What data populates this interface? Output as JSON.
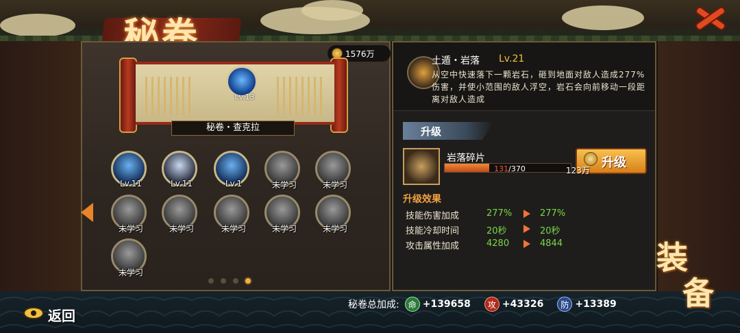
{
  "header": {
    "title": "秘卷"
  },
  "currency": {
    "amount": "1576万"
  },
  "scroll": {
    "name": "秘卷・查克拉",
    "level": "Lv.13"
  },
  "skills": [
    {
      "caption": "Lv.11",
      "state": "learned"
    },
    {
      "caption": "Lv.11",
      "state": "learned"
    },
    {
      "caption": "Lv.1",
      "state": "learned"
    },
    {
      "caption": "未学习",
      "state": "locked"
    },
    {
      "caption": "未学习",
      "state": "locked"
    },
    {
      "caption": "未学习",
      "state": "locked"
    },
    {
      "caption": "未学习",
      "state": "locked"
    },
    {
      "caption": "未学习",
      "state": "locked"
    },
    {
      "caption": "未学习",
      "state": "locked"
    },
    {
      "caption": "未学习",
      "state": "locked"
    },
    {
      "caption": "未学习",
      "state": "locked"
    }
  ],
  "pager": {
    "pages": 4,
    "current": 4
  },
  "detail": {
    "name": "土遁・岩落",
    "level": "Lv.21",
    "description": "从空中快速落下一颗岩石，砸到地面对敌人造成277%伤害，并使小范围的敌人浮空，岩石会向前移动一段距离对敌人造成"
  },
  "upgrade": {
    "section_title": "升级",
    "material_name": "岩落碎片",
    "material_current": "131",
    "material_required": "/370",
    "progress": 0.354,
    "cost": "123万",
    "button_label": "升级"
  },
  "effects": {
    "title": "升级效果",
    "rows": [
      {
        "label": "技能伤害加成",
        "current": "277%",
        "next": "277%"
      },
      {
        "label": "技能冷却时间",
        "current": "20秒",
        "next": "20秒"
      },
      {
        "label": "攻击属性加成",
        "current": "4280",
        "next": "4844"
      }
    ]
  },
  "equip_button": {
    "label_top": "装",
    "label_bottom": "备"
  },
  "footer": {
    "back_label": "返回",
    "bonus_label": "秘卷总加成:",
    "bonuses": [
      {
        "badge": "命",
        "value": "+139658",
        "color": "#2a7a3a"
      },
      {
        "badge": "攻",
        "value": "+43326",
        "color": "#b02a1a"
      },
      {
        "badge": "防",
        "value": "+13389",
        "color": "#2a4a8a"
      }
    ]
  }
}
